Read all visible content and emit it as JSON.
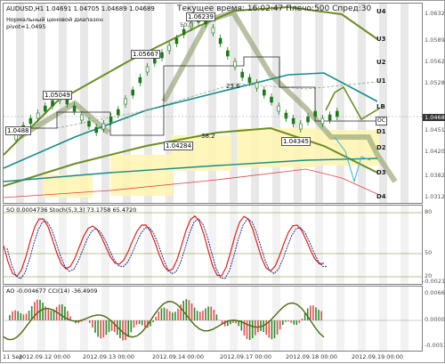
{
  "header": {
    "symbol_line": "AUDUSD,H1  1.04691 1.04705 1.04689 1.04689",
    "indicator_name": "Нормальный ценовой диапазон",
    "pivot": "pivot=1.0495",
    "server_info": "Текущее время: 16:02:47 Плечо:500 Спред:30"
  },
  "price_axis": [
    "1.06320",
    "1.05897",
    "1.05620",
    "1.05282",
    "1.04689",
    "1.04515",
    "1.04208",
    "1.03829",
    "1.03457",
    "1.03128"
  ],
  "level_labels": [
    "U4",
    "U3",
    "U2",
    "U1",
    "LB",
    "D1",
    "D2",
    "D3",
    "D4"
  ],
  "price_annotations": {
    "high1": "1.06239",
    "high2": "1.05667",
    "high3": "1.05049",
    "low1": "1.04284",
    "low2": "1.04345",
    "left_edge": "1.0488",
    "fib1": "23.6",
    "fib2": "38.2",
    "fib_top": "50.0",
    "oc_tag": "OC",
    "current_tag": "1.04689"
  },
  "stoch_panel": {
    "label": "SO 0.0004736  Stoch(5,3,3) 73.1758 65.4720",
    "axis": [
      "80",
      "50",
      "20",
      "-0.00217"
    ]
  },
  "cci_panel": {
    "label": "AO -0.004677  CCI(14) -36.4909",
    "axis": [
      "0.00661",
      "0.00000",
      "-0.00573"
    ]
  },
  "time_axis": [
    "11 Sep",
    "2012.09.12 00:00",
    "2012.09.13 00:00",
    "2012.09.14 00:00",
    "2012.09.17 00:00",
    "2012.09.18 00:00",
    "2012.09.19 00:00"
  ],
  "colors": {
    "candle": "#1a7a1a",
    "band_olive": "#6b8e23",
    "teal": "#1a8a8a",
    "zone_yellow": "#fff4b0",
    "grey_bars": "#e8e8e8",
    "macd_green": "#2e8b2e",
    "macd_red": "#e05050",
    "stoch_red": "#e02020"
  }
}
